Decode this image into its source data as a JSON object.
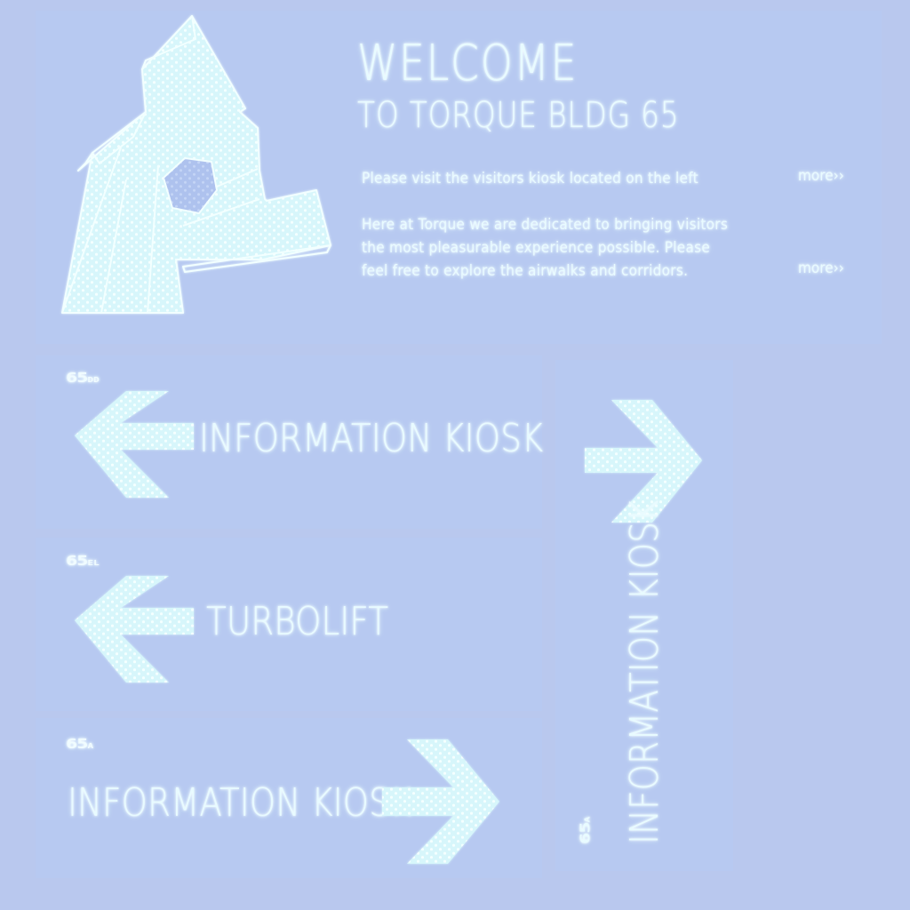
{
  "header": {
    "title": "WELCOME",
    "subtitle": "TO TORQUE BLDG 65",
    "intro_1": "Please visit the visitors kiosk located on the left",
    "intro_1_more": "more››",
    "intro_2_lines": [
      "Here at Torque we are dedicated to bringing visitors",
      "the most pleasurable experience possible.  Please",
      "feel free to explore the airwalks and corridors."
    ],
    "intro_2_more": "more››"
  },
  "signs": [
    {
      "code": "65",
      "code_suffix": "DD",
      "label": "INFORMATION KIOSK",
      "direction": "left"
    },
    {
      "code": "65",
      "code_suffix": "EL",
      "label": "TURBOLIFT",
      "direction": "left"
    },
    {
      "code": "65",
      "code_suffix": "A",
      "label": "INFORMATION KIOSK",
      "direction": "right"
    },
    {
      "code": "65",
      "code_suffix": "A",
      "label": "INFORMATION KIOSK",
      "direction": "right",
      "orientation": "vertical"
    }
  ],
  "icons": {
    "logo": "torque-building-logo",
    "arrow_left": "arrow-left-icon",
    "arrow_right": "arrow-right-icon"
  },
  "colors": {
    "background": "#b9c8ee",
    "foreground": "#e8fbff",
    "panel": "#b7c9f1"
  }
}
